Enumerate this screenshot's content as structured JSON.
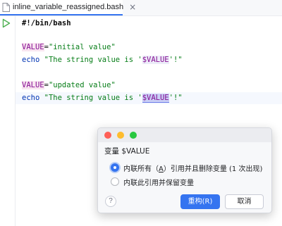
{
  "tab": {
    "filename": "inline_variable_reassigned.bash",
    "close_glyph": "×",
    "icon": "file-icon"
  },
  "gutter": {
    "run_icon": "run-icon",
    "accent": "#4caf50"
  },
  "code": {
    "lines": [
      {
        "shebang": "#!/bin/bash"
      },
      {},
      {
        "var": "VALUE",
        "eq": "=",
        "value": "\"initial value\""
      },
      {
        "kw": "echo",
        "str_pre": " \"The string value is '",
        "ref": "$VALUE",
        "str_post": "'!\""
      },
      {},
      {
        "var": "VALUE",
        "eq": "=",
        "value": "\"updated value\""
      },
      {
        "kw": "echo",
        "str_pre": " \"The string value is '",
        "ref": "$VALUE",
        "str_post": "'!\""
      }
    ]
  },
  "dialog": {
    "title": "变量 $VALUE",
    "options": [
      {
        "pre": "内联所有（",
        "mnemonic": "A",
        "post": "）引用并且删除变量 (1 次出现)",
        "checked": true
      },
      {
        "pre": "内联此引用并保留变量",
        "checked": false
      }
    ],
    "help_label": "?",
    "refactor_label": "重构(R)",
    "cancel_label": "取消"
  },
  "colors": {
    "accent": "#3574f0",
    "string": "#067d17",
    "keyword": "#0033b3",
    "variable": "#871094"
  }
}
